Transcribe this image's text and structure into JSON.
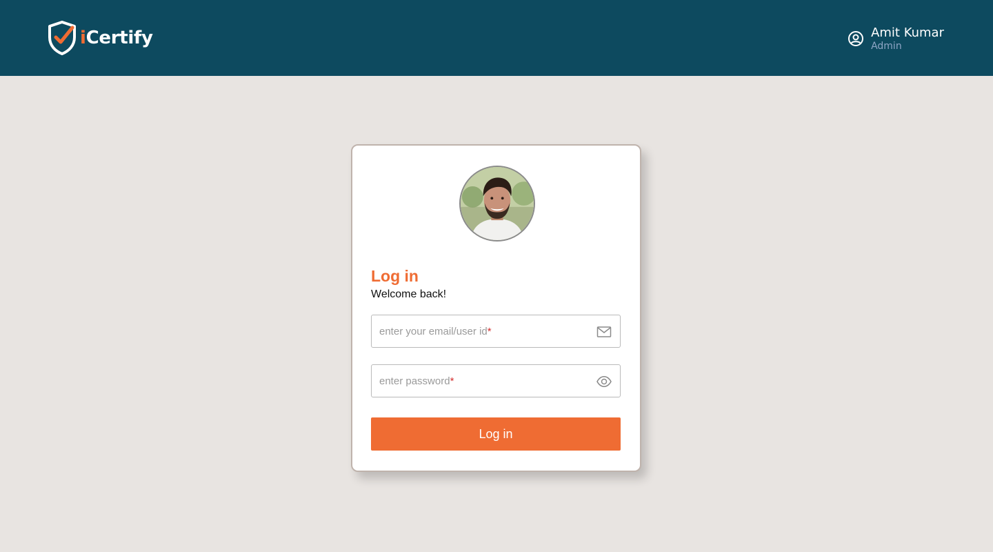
{
  "header": {
    "logo": {
      "prefix": "i",
      "name": "Certify"
    },
    "user": {
      "name": "Amit Kumar",
      "role": "Admin"
    }
  },
  "login": {
    "title": "Log in",
    "subtitle": "Welcome back!",
    "email": {
      "placeholder": "enter your email/user id",
      "required_mark": "*",
      "icon": "mail-icon"
    },
    "password": {
      "placeholder": "enter password",
      "required_mark": "*",
      "icon": "eye-icon"
    },
    "button_label": "Log in"
  },
  "colors": {
    "header_bg": "#0d4a5f",
    "page_bg": "#e8e4e1",
    "accent": "#ef6c33",
    "user_role": "#8fa6c6",
    "required": "#d32f2f"
  }
}
